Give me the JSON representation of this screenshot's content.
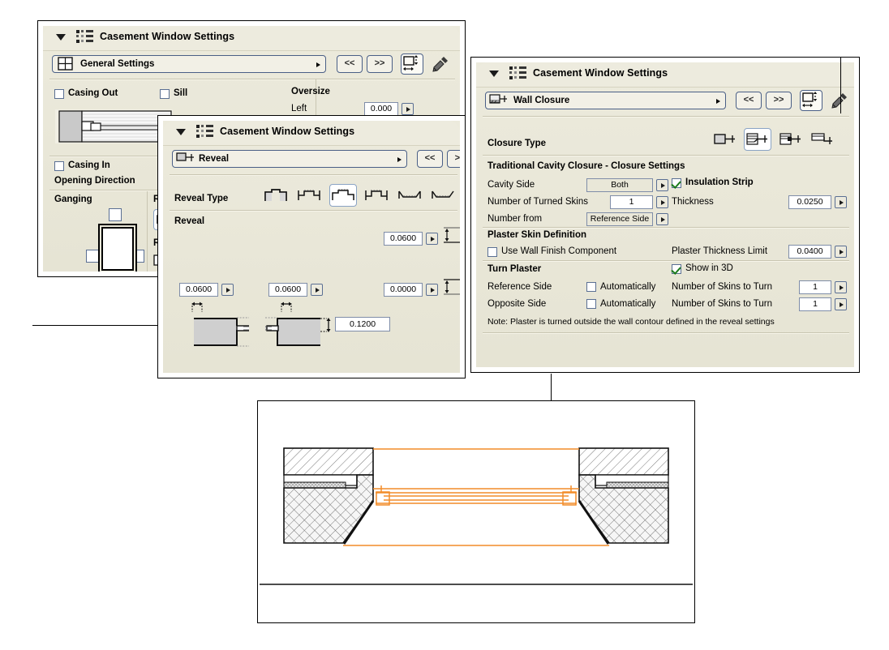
{
  "app": {
    "dialog_title": "Casement Window Settings"
  },
  "general_panel": {
    "title": "Casement Window Settings",
    "page_selector": {
      "label": "General Settings",
      "icon": "window-grid-icon"
    },
    "nav": {
      "prev": "<<",
      "next": ">>"
    },
    "tool_icons": [
      "resize-icon",
      "pipette-icon"
    ],
    "checkboxes": [
      {
        "label": "Casing Out",
        "checked": false
      },
      {
        "label": "Sill",
        "checked": false
      },
      {
        "label": "Casing In",
        "checked": false
      }
    ],
    "opening_direction_label": "Opening Direction",
    "oversize": {
      "title": "Oversize",
      "rows": [
        {
          "label": "Left",
          "value": "0.000"
        }
      ]
    },
    "ganging_label": "Ganging",
    "reveal_group_label_1": "Reve",
    "reveal_group_label_2": "Reve"
  },
  "reveal_panel": {
    "title": "Casement Window Settings",
    "page_selector": {
      "label": "Reveal",
      "icon": "reveal-profile-icon"
    },
    "nav": {
      "prev": "<<",
      "next": ">>"
    },
    "reveal_type_label": "Reveal Type",
    "reveal_type_count": 6,
    "reveal_type_selected_index": 2,
    "reveal_section_label": "Reveal",
    "fields": {
      "left_reveal": "0.0600",
      "right_reveal": "0.0600",
      "top_reveal": "0.0600",
      "depth": "0.1200",
      "bottom_reveal": "0.0000"
    }
  },
  "wall_closure_panel": {
    "title": "Casement Window Settings",
    "page_selector": {
      "label": "Wall Closure",
      "icon": "wall-closure-icon"
    },
    "nav": {
      "prev": "<<",
      "next": ">>"
    },
    "closure_type_label": "Closure Type",
    "closure_type_count": 4,
    "closure_type_selected_index": 1,
    "traditional_header": "Traditional Cavity Closure - Closure Settings",
    "cavity_side": {
      "label": "Cavity Side",
      "value": "Both"
    },
    "insulation_strip": {
      "label": "Insulation Strip",
      "checked": true
    },
    "turned_skins": {
      "label": "Number of Turned Skins",
      "value": "1"
    },
    "thickness": {
      "label": "Thickness",
      "value": "0.0250"
    },
    "number_from": {
      "label": "Number from",
      "value": "Reference Side"
    },
    "plaster_header": "Plaster Skin Definition",
    "use_wall_finish": {
      "label": "Use Wall Finish Component",
      "checked": false
    },
    "plaster_thickness_limit": {
      "label": "Plaster Thickness Limit",
      "value": "0.0400"
    },
    "turn_plaster_header": "Turn Plaster",
    "show_in_3d": {
      "label": "Show in 3D",
      "checked": true
    },
    "reference_side": {
      "label": "Reference Side",
      "auto_label": "Automatically",
      "auto_checked": false,
      "skins_label": "Number of Skins to Turn",
      "skins_value": "1"
    },
    "opposite_side": {
      "label": "Opposite Side",
      "auto_label": "Automatically",
      "auto_checked": false,
      "skins_label": "Number of Skins to Turn",
      "skins_value": "1"
    },
    "note": "Note: Plaster is turned outside the wall contour defined in the reveal settings"
  },
  "preview": {
    "name": "window-section-preview",
    "accent_color": "#f28c28",
    "line_color": "#000000"
  }
}
